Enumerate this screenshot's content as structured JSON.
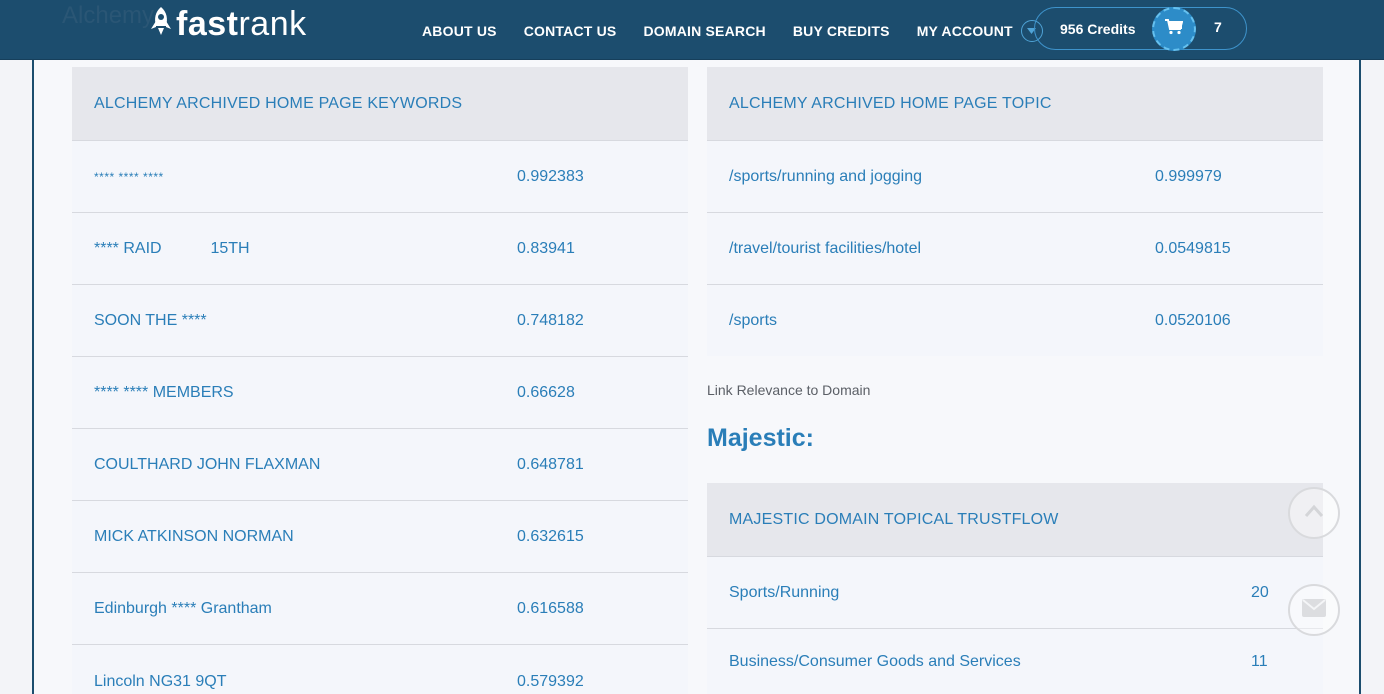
{
  "page": {
    "ghost_title": "Alchemy"
  },
  "header": {
    "logo_fast": "fast",
    "logo_rank": "rank",
    "nav": {
      "about": "ABOUT US",
      "contact": "CONTACT US",
      "domain_search": "DOMAIN SEARCH",
      "buy_credits": "BUY CREDITS",
      "my_account": "MY ACCOUNT"
    },
    "credits_label": "956 Credits",
    "cart_count": "7"
  },
  "keywords_table": {
    "header": "ALCHEMY ARCHIVED HOME PAGE KEYWORDS",
    "rows": [
      {
        "keyword": "**** **** ****",
        "score": "0.992383"
      },
      {
        "keyword": "**** RAID           15TH",
        "score": "0.83941"
      },
      {
        "keyword": "SOON THE ****",
        "score": "0.748182"
      },
      {
        "keyword": "**** **** MEMBERS",
        "score": "0.66628"
      },
      {
        "keyword": "COULTHARD JOHN FLAXMAN",
        "score": "0.648781"
      },
      {
        "keyword": "MICK ATKINSON NORMAN",
        "score": "0.632615"
      },
      {
        "keyword": "Edinburgh **** Grantham",
        "score": "0.616588"
      },
      {
        "keyword": "Lincoln NG31 9QT",
        "score": "0.579392"
      }
    ]
  },
  "topic_table": {
    "header": "ALCHEMY ARCHIVED HOME PAGE TOPIC",
    "rows": [
      {
        "topic": "/sports/running and jogging",
        "score": "0.999979"
      },
      {
        "topic": "/travel/tourist facilities/hotel",
        "score": "0.0549815"
      },
      {
        "topic": "/sports",
        "score": "0.0520106"
      }
    ]
  },
  "link_relevance_label": "Link Relevance to Domain",
  "majestic_heading": "Majestic:",
  "trustflow_table": {
    "header": "MAJESTIC DOMAIN TOPICAL TRUSTFLOW",
    "rows": [
      {
        "topic": "Sports/Running",
        "value": "20"
      },
      {
        "topic": "Business/Consumer Goods and Services",
        "value": "11"
      }
    ]
  },
  "icons": {
    "logo": "rocket-icon",
    "account_dropdown": "chevron-down-icon",
    "cart": "cart-icon",
    "scroll_top": "arrow-up-icon",
    "mail": "mail-icon"
  },
  "colors": {
    "nav_bg": "#1c4d6e",
    "accent": "#2a7eb8",
    "cart_bg": "#2d8cc8"
  }
}
